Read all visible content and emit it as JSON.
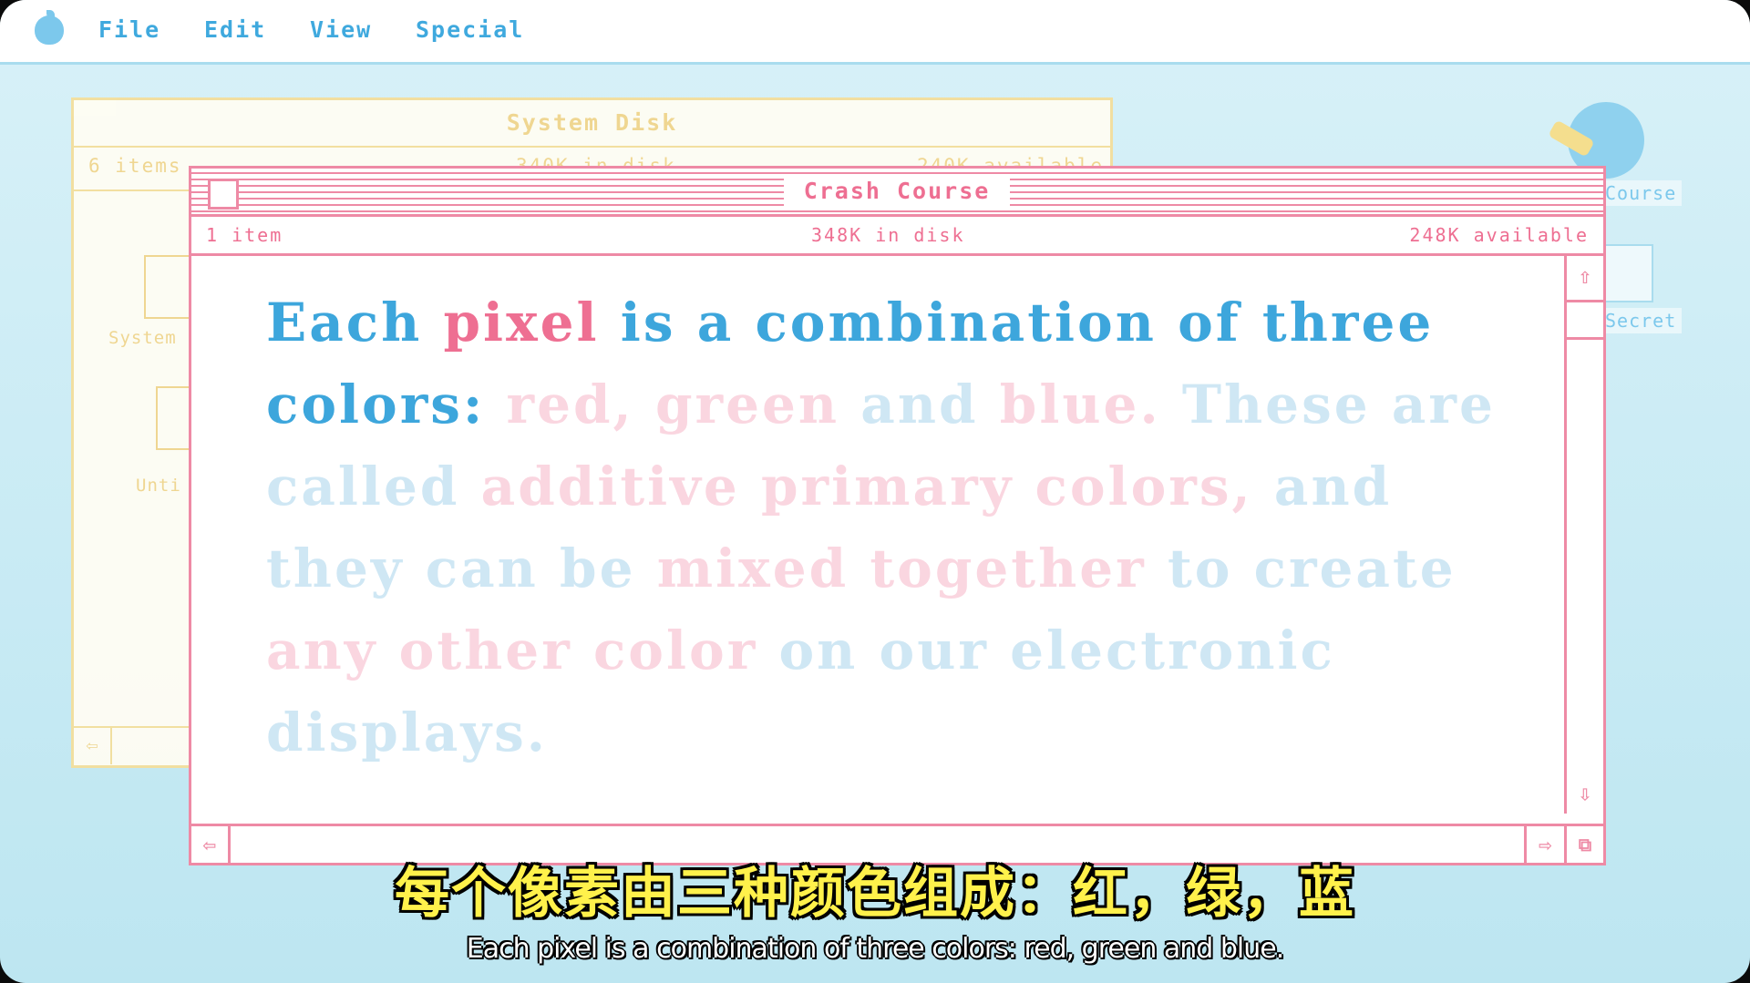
{
  "menubar": {
    "icon": "apple-icon",
    "items": [
      {
        "label": "File"
      },
      {
        "label": "Edit"
      },
      {
        "label": "View"
      },
      {
        "label": "Special"
      }
    ]
  },
  "system_disk": {
    "title": "System Disk",
    "items": "6 items",
    "in_disk": "340K in disk",
    "available": "240K available",
    "folders": [
      {
        "label": "System"
      },
      {
        "label": "Unti"
      }
    ]
  },
  "desktop": {
    "icons": [
      {
        "label": "Course"
      },
      {
        "label": "Secret"
      }
    ]
  },
  "window": {
    "title": "Crash Course",
    "items": "1 item",
    "in_disk": "348K in disk",
    "available": "248K available"
  },
  "body_lines": [
    [
      {
        "t": "Each",
        "c": "blue"
      },
      {
        "t": "pixel",
        "c": "pink"
      },
      {
        "t": "is",
        "c": "blue"
      },
      {
        "t": "a",
        "c": "blue"
      },
      {
        "t": "combination",
        "c": "blue"
      },
      {
        "t": "of",
        "c": "blue"
      },
      {
        "t": "three",
        "c": "blue"
      }
    ],
    [
      {
        "t": "colors:",
        "c": "blue"
      },
      {
        "t": "red,",
        "c": "fpink"
      },
      {
        "t": "green",
        "c": "fpink"
      },
      {
        "t": "and",
        "c": "fblue"
      },
      {
        "t": "blue.",
        "c": "fpink"
      },
      {
        "t": "These",
        "c": "fblue"
      },
      {
        "t": "are",
        "c": "fblue"
      }
    ],
    [
      {
        "t": "called",
        "c": "fblue"
      },
      {
        "t": "additive",
        "c": "fpink"
      },
      {
        "t": "primary",
        "c": "fpink"
      },
      {
        "t": "colors,",
        "c": "fpink"
      },
      {
        "t": "and",
        "c": "fblue"
      }
    ],
    [
      {
        "t": "they",
        "c": "fblue"
      },
      {
        "t": "can",
        "c": "fblue"
      },
      {
        "t": "be",
        "c": "fblue"
      },
      {
        "t": "mixed",
        "c": "fpink"
      },
      {
        "t": "together",
        "c": "fpink"
      },
      {
        "t": "to",
        "c": "fblue"
      },
      {
        "t": "create",
        "c": "fblue"
      }
    ],
    [
      {
        "t": "any",
        "c": "fpink"
      },
      {
        "t": "other",
        "c": "fpink"
      },
      {
        "t": "color",
        "c": "fpink"
      },
      {
        "t": "on",
        "c": "fblue"
      },
      {
        "t": "our",
        "c": "fblue"
      },
      {
        "t": "electronic",
        "c": "fblue"
      }
    ],
    [
      {
        "t": "displays.",
        "c": "fblue"
      }
    ]
  ],
  "subtitles": {
    "cn": "每个像素由三种颜色组成：红，绿，蓝",
    "en": "Each pixel is a combination of three colors: red, green and blue."
  },
  "colors": {
    "blue": "#3da6dc",
    "pink": "#ee6f92",
    "window_border": "#ee8aa5",
    "system_disk_border": "#f4df9c"
  }
}
